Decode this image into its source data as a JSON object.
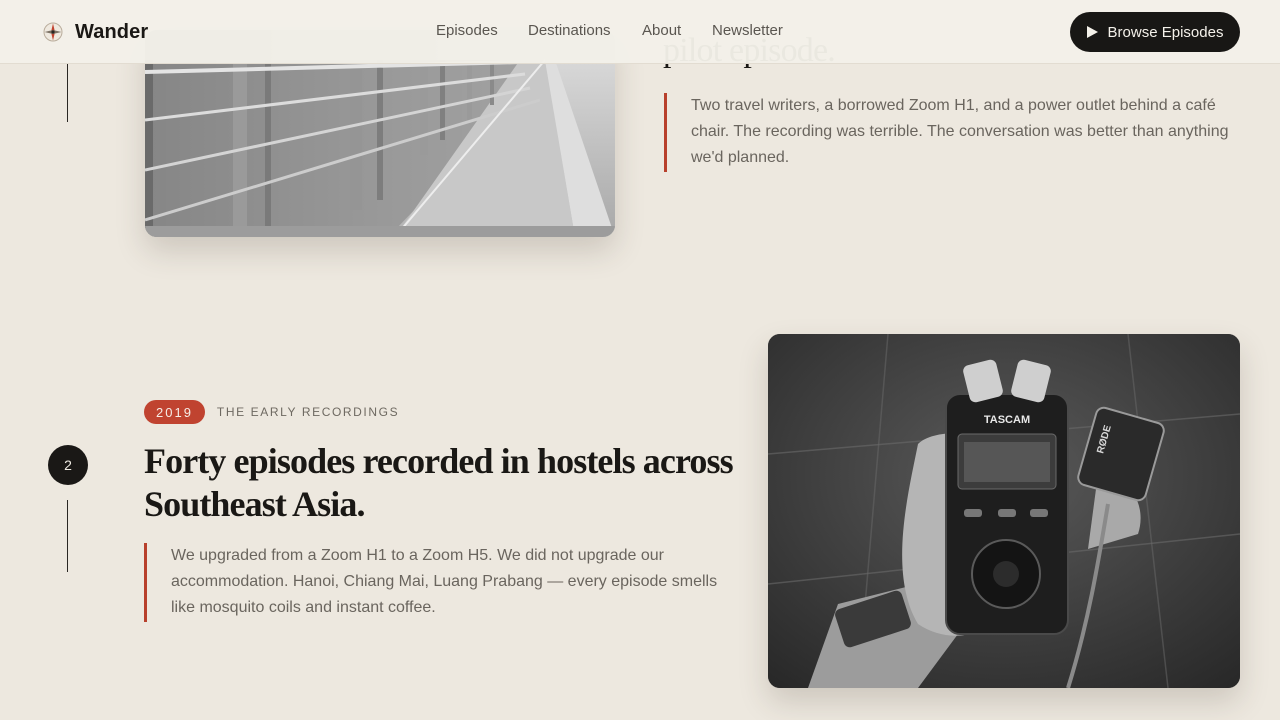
{
  "header": {
    "brand": "Wander",
    "nav": [
      {
        "label": "Episodes"
      },
      {
        "label": "Destinations"
      },
      {
        "label": "About"
      },
      {
        "label": "Newsletter"
      }
    ],
    "cta_label": "Browse Episodes"
  },
  "timeline": [
    {
      "heading_fragment": "pilot episode.",
      "quote": "Two travel writers, a borrowed Zoom H1, and a power outlet behind a café chair. The recording was terrible. The conversation was better than anything we'd planned.",
      "photo_icon": "escalator-photo"
    },
    {
      "step": "2",
      "year": "2019",
      "era": "THE EARLY RECORDINGS",
      "heading": "Forty episodes recorded in hostels across Southeast Asia.",
      "quote": "We upgraded from a Zoom H1 to a Zoom H5. We did not upgrade our accommodation. Hanoi, Chiang Mai, Luang Prabang — every episode smells like mosquito coils and instant coffee.",
      "photo_icon": "audio-recorder-photo",
      "photo_text": [
        "TASCAM",
        "RØDE"
      ]
    }
  ],
  "colors": {
    "background": "#ede8df",
    "accent": "#c04330",
    "dark": "#181715",
    "text_muted": "#6a655e"
  }
}
